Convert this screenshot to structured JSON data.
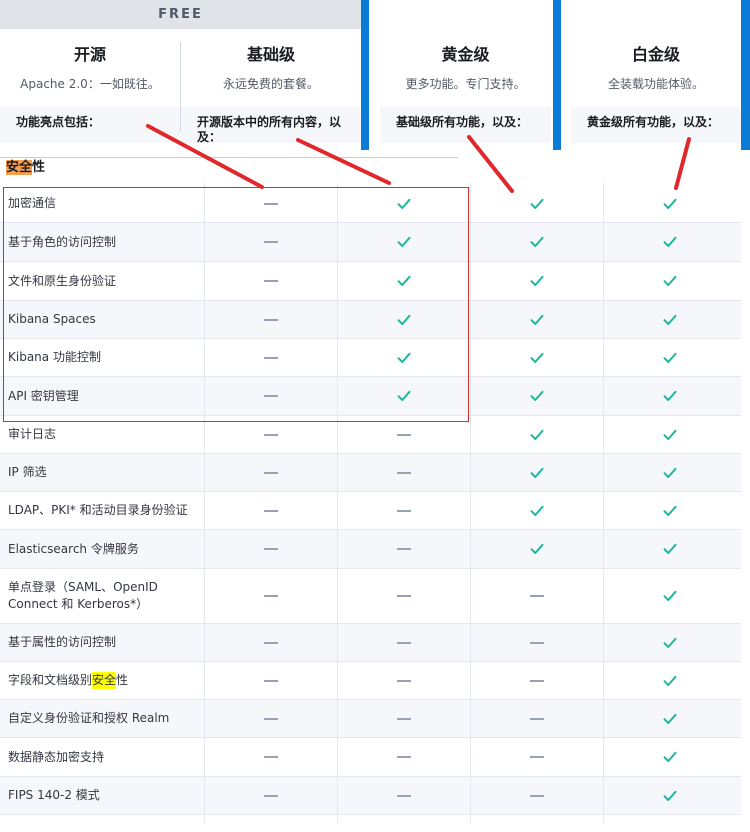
{
  "header": {
    "free_badge": "FREE",
    "tiers": [
      {
        "name": "开源",
        "desc": "Apache 2.0：一如既往。",
        "includes": "功能亮点包括："
      },
      {
        "name": "基础级",
        "desc": "永远免费的套餐。",
        "includes": "开源版本中的所有内容，以及："
      },
      {
        "name": "黄金级",
        "desc": "更多功能。专门支持。",
        "includes": "基础级所有功能，以及："
      },
      {
        "name": "白金级",
        "desc": "全装载功能体验。",
        "includes": "黄金级所有功能，以及："
      }
    ]
  },
  "section": {
    "title_hl": "安全",
    "title_rest": "性"
  },
  "rows": [
    {
      "label": "加密通信",
      "vals": [
        0,
        1,
        1,
        1
      ]
    },
    {
      "label": "基于角色的访问控制",
      "vals": [
        0,
        1,
        1,
        1
      ]
    },
    {
      "label": "文件和原生身份验证",
      "vals": [
        0,
        1,
        1,
        1
      ]
    },
    {
      "label": "Kibana Spaces",
      "vals": [
        0,
        1,
        1,
        1
      ]
    },
    {
      "label": "Kibana 功能控制",
      "vals": [
        0,
        1,
        1,
        1
      ]
    },
    {
      "label": "API 密钥管理",
      "vals": [
        0,
        1,
        1,
        1
      ]
    },
    {
      "label": "审计日志",
      "vals": [
        0,
        0,
        1,
        1
      ]
    },
    {
      "label": "IP 筛选",
      "vals": [
        0,
        0,
        1,
        1
      ]
    },
    {
      "label": "LDAP、PKI* 和活动目录身份验证",
      "vals": [
        0,
        0,
        1,
        1
      ]
    },
    {
      "label": "Elasticsearch 令牌服务",
      "vals": [
        0,
        0,
        1,
        1
      ]
    },
    {
      "label": "单点登录（SAML、OpenID Connect 和 Kerberos*）",
      "vals": [
        0,
        0,
        0,
        1
      ]
    },
    {
      "label": "基于属性的访问控制",
      "vals": [
        0,
        0,
        0,
        1
      ]
    },
    {
      "label_pre": "字段和文档级别",
      "label_hl": "安全",
      "label_post": "性",
      "vals": [
        0,
        0,
        0,
        1
      ]
    },
    {
      "label": "自定义身份验证和授权 Realm",
      "vals": [
        0,
        0,
        0,
        1
      ]
    },
    {
      "label": "数据静态加密支持",
      "vals": [
        0,
        0,
        0,
        1
      ]
    },
    {
      "label": "FIPS 140-2 模式",
      "vals": [
        0,
        0,
        0,
        1
      ]
    }
  ],
  "colors": {
    "check": "#1fb89a",
    "accent": "#0a7bd6",
    "annotation": "#e0282c"
  }
}
